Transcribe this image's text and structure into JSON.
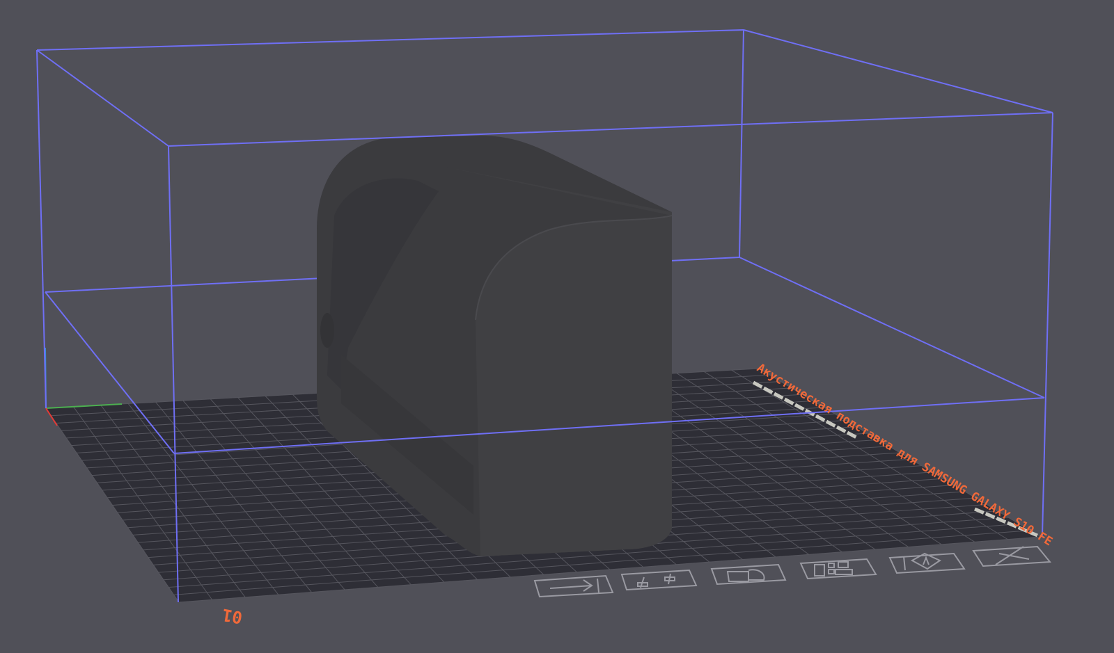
{
  "viewport": {
    "background": "#505058",
    "bed_color": "#2e2e36",
    "grid_color": "#55555d",
    "bbox_color": "#6f6ff5",
    "model_color": "#3d3d40"
  },
  "plate": {
    "number": "01",
    "name": "Акустическая подставка для SAMSUNG GALAXY S10 FE",
    "label_color": "#f0693a"
  },
  "plate_toolbar": [
    {
      "id": "pick",
      "icon": "pick-icon",
      "tooltip": ""
    },
    {
      "id": "settings",
      "icon": "sliders-icon"
    },
    {
      "id": "lock",
      "icon": "lock-icon"
    },
    {
      "id": "arrange",
      "icon": "arrange-icon"
    },
    {
      "id": "orient",
      "icon": "auto-orient-icon"
    },
    {
      "id": "delete",
      "icon": "close-icon"
    }
  ]
}
